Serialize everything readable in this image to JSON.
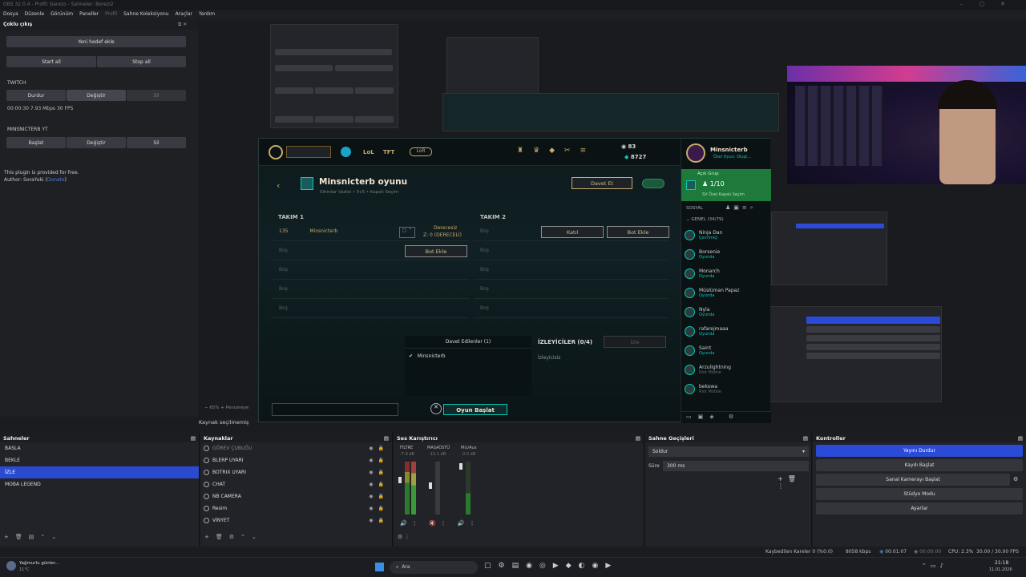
{
  "titlebar": {
    "title": "OBS 32.0.4 - Profil: barezo - Sahneler: Berezi2"
  },
  "menu": [
    "Dosya",
    "Düzenle",
    "Görünüm",
    "Paneller",
    "Profil",
    "Sahne Koleksiyonu",
    "Araçlar",
    "Yardım"
  ],
  "multi_output": {
    "title": "Çoklu çıkış",
    "add_target": "Yeni hedef ekle",
    "start_all": "Start all",
    "stop_all": "Stop all",
    "targets": [
      {
        "name": "TWITCH",
        "btn1": "Durdur",
        "btn2": "Değiştir",
        "btn3": "Sil",
        "stats": "00:00:30  7.93 Mbps  30 FPS"
      },
      {
        "name": "MINSNICTERB YT",
        "btn1": "Başlat",
        "btn2": "Değiştir",
        "btn3": "Sil"
      }
    ],
    "note1": "This plugin is provided for free.",
    "note2": "Author: SoraYuki (",
    "note2_link": "Donate",
    "note2_end": ")"
  },
  "preview": {
    "zoom": "65%",
    "window_label": "Pencereye",
    "source_status": "Kaynak seçilmemiş"
  },
  "lol": {
    "nav": [
      "LoL",
      "TFT"
    ],
    "lor_label": "LoR",
    "currency_rp": "83",
    "currency_be": "8727",
    "lobby_title": "Minsnicterb oyunu",
    "lobby_subtitle": "Sihirdar Vadisi  •  5v5  •  Kapalı Seçim",
    "invite_button": "Davet Et",
    "team1": "TAKIM 1",
    "team2": "TAKIM 2",
    "level": "135",
    "player_name": "Minsnicterb",
    "rank_label": "Derecesiz",
    "rank_sub": "Z: 0 (DERECELİ)",
    "empty": "Boş",
    "bot_add": "Bot Ekle",
    "join": "Katıl",
    "invited_header": "Davet Edilenler (1)",
    "invited_name": "Minsnicterb",
    "spectators": "İZLEYİCİLER (0/4)",
    "no_spectators": "İzleyicisiz",
    "watch_btn": "İzle",
    "start_game": "Oyun Başlat",
    "social": {
      "username": "Minsnicterb",
      "status": "Özel Oyun: Oluşt...",
      "open_group": "Açık Grup",
      "group_count": "1/10",
      "group_sub": "SV Özel Kapalı Seçim",
      "social_label": "SOSYAL",
      "general": "GENEL (34/79)",
      "friends": [
        {
          "name": "Ninja Dan",
          "status": "Çevrimiçi"
        },
        {
          "name": "Borsenie",
          "status": "Oyunda"
        },
        {
          "name": "Monarch",
          "status": "Oyunda"
        },
        {
          "name": "Müslüman Papaz",
          "status": "Oyunda"
        },
        {
          "name": "Nyla",
          "status": "Oyunda"
        },
        {
          "name": "rafarejmaaa",
          "status": "Oyunda"
        },
        {
          "name": "Saint",
          "status": "Oyunda"
        },
        {
          "name": "Arzulightning",
          "status": "Riot Mobile"
        },
        {
          "name": "bekowa",
          "status": "Riot Mobile"
        }
      ]
    }
  },
  "scenes": {
    "title": "Sahneler",
    "items": [
      "BASLA",
      "BEKLE",
      "İZLE",
      "MOBA LEGEND"
    ],
    "selected": 2
  },
  "sources": {
    "title": "Kaynaklar",
    "items": [
      "GÖREV ÇUBUĞU",
      "BLERP UYARI",
      "BOTRIX UYARI",
      "CHAT",
      "NB CAMERA",
      "Resim",
      "VİNYET"
    ]
  },
  "mixer": {
    "title": "Ses Karıştırıcı",
    "channels": [
      {
        "name": "FİLTRE",
        "db": "-7.9 dB"
      },
      {
        "name": "MASAÜSTÜ",
        "db": "-15.1 dB"
      },
      {
        "name": "Mic/Aux",
        "db": "0.0 dB"
      }
    ]
  },
  "transitions": {
    "title": "Sahne Geçişleri",
    "selected": "Soldur",
    "duration_label": "Süre",
    "duration": "300 ms"
  },
  "controls": {
    "title": "Kontroller",
    "buttons": [
      "Yayını Durdur",
      "Kaydı Başlat",
      "Sanal Kamerayı Başlat",
      "Stüdyo Modu",
      "Ayarlar"
    ]
  },
  "status": {
    "dropped": "Kaybedilen Kareler 0 (%0.0)",
    "bitrate": "8058 kbps",
    "stream_time": "00:01:07",
    "rec_time": "00:00:00",
    "cpu": "CPU: 2.3%",
    "fps": "30.00 / 30.00 FPS"
  },
  "taskbar": {
    "weather": "Yağmurlu günler...",
    "temp": "11°C",
    "search": "Ara",
    "time": "21:18",
    "date": "11.01.2026"
  },
  "colors": {
    "accent": "#2b4ad8",
    "lol_gold": "#c8aa6e",
    "lol_cyan": "#0ac8b9"
  }
}
